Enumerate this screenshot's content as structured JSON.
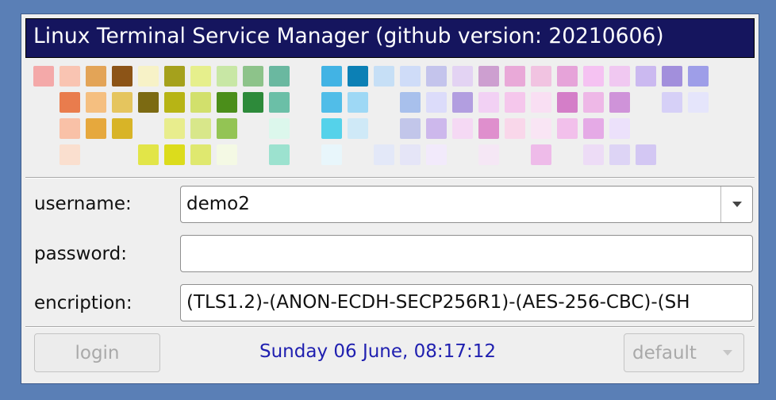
{
  "window": {
    "title": "Linux Terminal Service Manager (github version: 20210606)"
  },
  "colors": {
    "desktop": "#5a7fb6",
    "titlebar": "#15155e",
    "datetime": "#2020b0",
    "pixel_grid": [
      [
        "#f4a9a9",
        "#f9c4b2",
        "#e3a457",
        "#8c5417",
        "#f7f2c7",
        "#a5a11c",
        "#e6ef8c",
        "#c8e7a5",
        "#8dc38a",
        "#6ab8a0",
        "",
        "#42b3e4",
        "#0c80b5",
        "#c6dff6",
        "#cfdcf8",
        "#c4c4ec",
        "#e3d3f3",
        "#cd9fd0",
        "#e9a9d8",
        "#f1c3e1",
        "#e6a3d9",
        "#f5c2f2",
        "#f0c8f1",
        "#cbb9f0",
        "#a28fdc",
        "#9e9ee8"
      ],
      [
        "",
        "#e97c4d",
        "#f5bf80",
        "#e5c55e",
        "#7c6a12",
        "#b7b415",
        "#d2e06c",
        "#4b8e1a",
        "#2d8a3a",
        "#6bbfa7",
        "",
        "#51bde8",
        "#9ed8f5",
        "",
        "#a8c0ec",
        "#dcdcfa",
        "#b29ee0",
        "#f2d1f4",
        "#f5c7ec",
        "#f9dff3",
        "#d47ec8",
        "#eeb8e7",
        "#cf93d9",
        "",
        "#d6d0f7",
        "#e5e5fb"
      ],
      [
        "",
        "#f9c1a7",
        "#e6a83d",
        "#d8b427",
        "",
        "#e8ed8d",
        "#d8e78a",
        "#93c454",
        "",
        "#dcf7ec",
        "",
        "#55d2ea",
        "#cfe9f7",
        "",
        "#c2c6ea",
        "#cdb8ec",
        "#f5d9f4",
        "#df8fcd",
        "#f9d7ea",
        "#f9e5f4",
        "#f2c0eb",
        "#e5aae6",
        "#ece1fb",
        "",
        "",
        ""
      ],
      [
        "",
        "#fadfcf",
        "",
        "",
        "#e2e548",
        "#dcdc1c",
        "#dfe86f",
        "#f4f9e4",
        "",
        "#9ce2cf",
        "",
        "#e8f6fb",
        "",
        "#e3e8f8",
        "#e5e5f7",
        "#f2eafb",
        "",
        "#f5e7f5",
        "",
        "#eebbe9",
        "",
        "#eddcf6",
        "#ddd4f5",
        "#d3c7f3",
        "",
        ""
      ]
    ]
  },
  "form": {
    "username": {
      "label": "username:",
      "value": "demo2"
    },
    "password": {
      "label": "password:",
      "value": ""
    },
    "encryption": {
      "label": "encription:",
      "value": "(TLS1.2)-(ANON-ECDH-SECP256R1)-(AES-256-CBC)-(SH"
    }
  },
  "footer": {
    "login_label": "login",
    "datetime": "Sunday 06 June, 08:17:12",
    "default_label": "default"
  },
  "icons": {
    "username_dropdown": "chevron-down-icon",
    "default_dropdown": "chevron-down-icon"
  }
}
